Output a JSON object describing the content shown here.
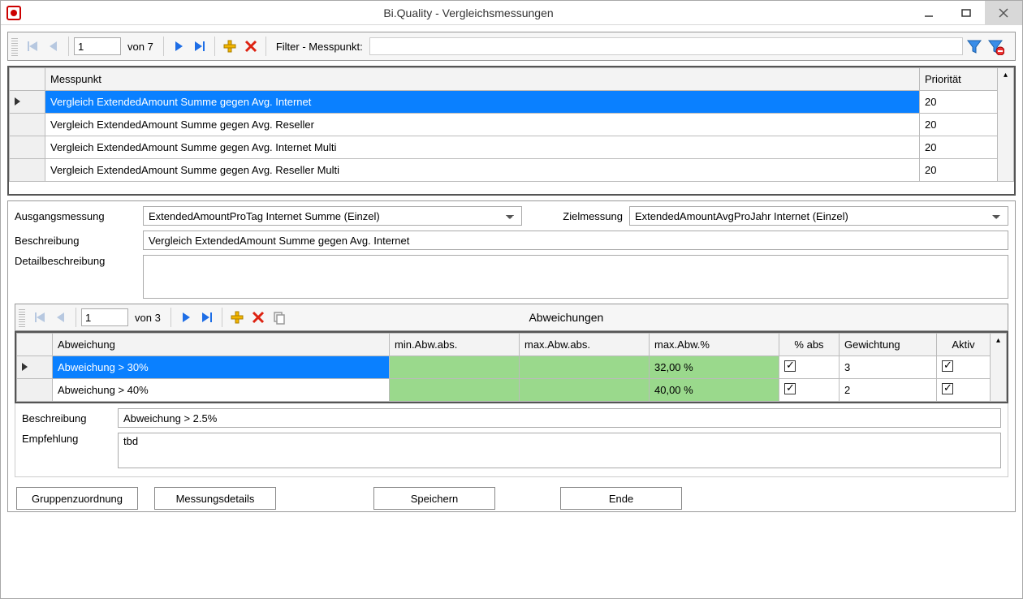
{
  "window": {
    "title": "Bi.Quality - Vergleichsmessungen"
  },
  "nav1": {
    "current": "1",
    "of_label": "von 7",
    "filter_label": "Filter - Messpunkt:"
  },
  "grid1": {
    "headers": {
      "messpunkt": "Messpunkt",
      "prioritaet": "Priorität"
    },
    "rows": [
      {
        "messpunkt": "Vergleich ExtendedAmount Summe gegen Avg. Internet",
        "prioritaet": "20",
        "selected": true
      },
      {
        "messpunkt": "Vergleich ExtendedAmount Summe gegen Avg. Reseller",
        "prioritaet": "20",
        "selected": false
      },
      {
        "messpunkt": "Vergleich ExtendedAmount Summe gegen Avg. Internet Multi",
        "prioritaet": "20",
        "selected": false
      },
      {
        "messpunkt": "Vergleich ExtendedAmount Summe gegen Avg. Reseller Multi",
        "prioritaet": "20",
        "selected": false
      }
    ]
  },
  "form1": {
    "labels": {
      "ausgang": "Ausgangsmessung",
      "ziel": "Zielmessung",
      "beschreibung": "Beschreibung",
      "detail": "Detailbeschreibung"
    },
    "values": {
      "ausgang": "ExtendedAmountProTag Internet Summe (Einzel)",
      "ziel": "ExtendedAmountAvgProJahr Internet (Einzel)",
      "beschreibung": "Vergleich ExtendedAmount Summe gegen Avg. Internet",
      "detail": ""
    }
  },
  "nav2": {
    "current": "1",
    "of_label": "von 3",
    "section_title": "Abweichungen"
  },
  "grid2": {
    "headers": {
      "abweichung": "Abweichung",
      "min_abs": "min.Abw.abs.",
      "max_abs": "max.Abw.abs.",
      "max_pct": "max.Abw.%",
      "pct_abs": "% abs",
      "gewichtung": "Gewichtung",
      "aktiv": "Aktiv"
    },
    "rows": [
      {
        "abweichung": "Abweichung > 30%",
        "min_abs": "",
        "max_abs": "",
        "max_pct": "32,00 %",
        "pct_abs": true,
        "gewichtung": "3",
        "aktiv": true,
        "selected": true
      },
      {
        "abweichung": "Abweichung > 40%",
        "min_abs": "",
        "max_abs": "",
        "max_pct": "40,00 %",
        "pct_abs": true,
        "gewichtung": "2",
        "aktiv": true,
        "selected": false
      }
    ]
  },
  "form2": {
    "labels": {
      "beschreibung": "Beschreibung",
      "empfehlung": "Empfehlung"
    },
    "values": {
      "beschreibung": "Abweichung > 2.5%",
      "empfehlung": "tbd"
    }
  },
  "buttons": {
    "gruppen": "Gruppenzuordnung",
    "details": "Messungsdetails",
    "speichern": "Speichern",
    "ende": "Ende"
  }
}
